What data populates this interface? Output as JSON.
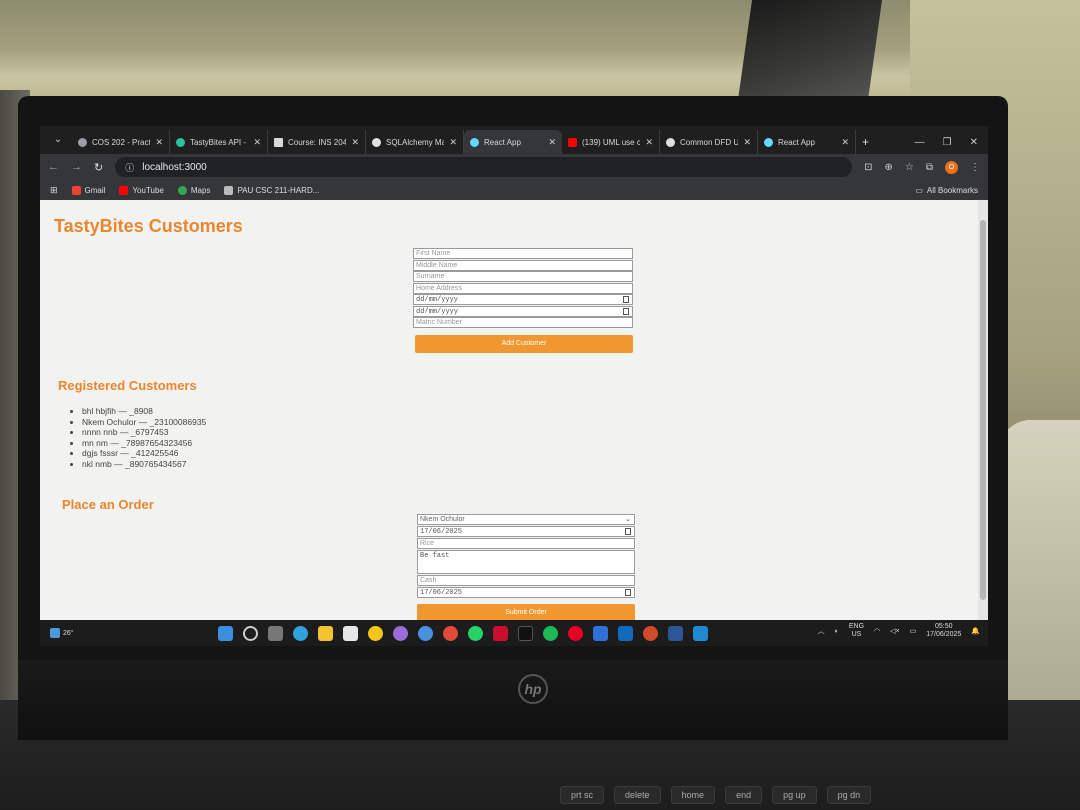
{
  "browser": {
    "tabs": [
      {
        "label": "COS 202 - Practi",
        "color": "#9aa0a6",
        "active": false
      },
      {
        "label": "TastyBites API -",
        "color": "#27c39f",
        "active": false
      },
      {
        "label": "Course: INS 204",
        "color": "#d9d9d9",
        "active": false
      },
      {
        "label": "SQLAlchemy Ma",
        "color": "#e0e0e0",
        "active": false
      },
      {
        "label": "React App",
        "color": "#61dafb",
        "active": true
      },
      {
        "label": "(139) UML use c",
        "color": "#ff0000",
        "active": false
      },
      {
        "label": "Common DFD U",
        "color": "#e0e0e0",
        "active": false
      },
      {
        "label": "React App",
        "color": "#61dafb",
        "active": false
      }
    ],
    "url": "localhost:3000",
    "profile_initial": "O",
    "bookmarks": [
      {
        "label": "Gmail",
        "color": "#ea4335"
      },
      {
        "label": "YouTube",
        "color": "#ff0000"
      },
      {
        "label": "Maps",
        "color": "#34a853"
      },
      {
        "label": "PAU CSC 211-HARD...",
        "color": "#bbbbbb"
      }
    ],
    "all_bookmarks": "All Bookmarks"
  },
  "page": {
    "title": "TastyBites Customers",
    "customer_form": {
      "first_name_placeholder": "First Name",
      "middle_name_placeholder": "Middle Name",
      "surname_placeholder": "Surname",
      "address_placeholder": "Home Address",
      "date1": "dd/mm/yyyy",
      "date2": "dd/mm/yyyy",
      "matric_placeholder": "Matric Number",
      "submit_label": "Add Customer"
    },
    "registered_title": "Registered Customers",
    "customers": [
      "bhl hbjfih — _8908",
      "Nkem Ochulor — _23100086935",
      "nnnn nnb — _6797453",
      "mn nm — _78987654323456",
      "dgjs fsssr — _412425546",
      "nkl nmb — _890765434567"
    ],
    "order_title": "Place an Order",
    "order_form": {
      "customer": "Nkem Ochulor",
      "date": "17/06/2025",
      "item": "Rice",
      "notes": "Be fast",
      "payment": "Cash",
      "delivery_date": "17/06/2025",
      "submit_label": "Submit Order"
    }
  },
  "taskbar": {
    "temperature": "26°",
    "lang_top": "ENG",
    "lang_bottom": "US",
    "time": "05:50",
    "date": "17/06/2025"
  },
  "keyboard": {
    "keys": [
      "prt sc",
      "delete",
      "home",
      "end",
      "pg up",
      "pg dn"
    ]
  },
  "accent_color": "#e8872e"
}
